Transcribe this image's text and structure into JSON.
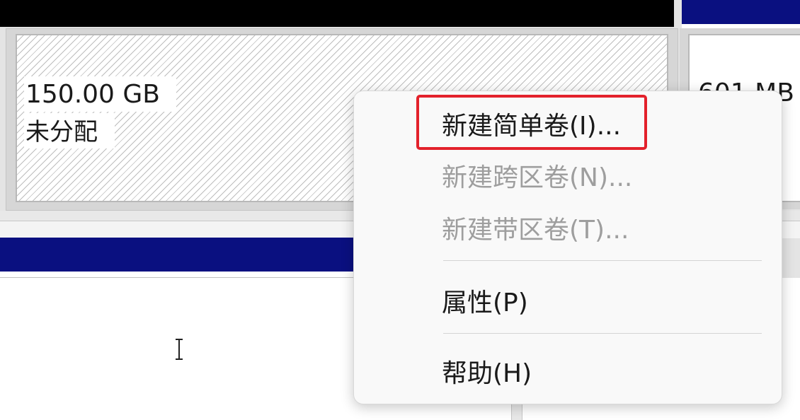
{
  "disk": {
    "unallocated": {
      "size": "150.00 GB",
      "status": "未分配"
    },
    "right_partition": {
      "size": "601 MB"
    }
  },
  "context_menu": {
    "items": [
      {
        "label": "新建简单卷(I)...",
        "enabled": true,
        "highlighted": true
      },
      {
        "label": "新建跨区卷(N)...",
        "enabled": false
      },
      {
        "label": "新建带区卷(T)...",
        "enabled": false
      },
      {
        "label": "属性(P)",
        "enabled": true
      },
      {
        "label": "帮助(H)",
        "enabled": true
      }
    ]
  },
  "colors": {
    "highlight": "#e3212b",
    "volume_bar": "#0a1080",
    "disabled_text": "#9e9e9e"
  }
}
